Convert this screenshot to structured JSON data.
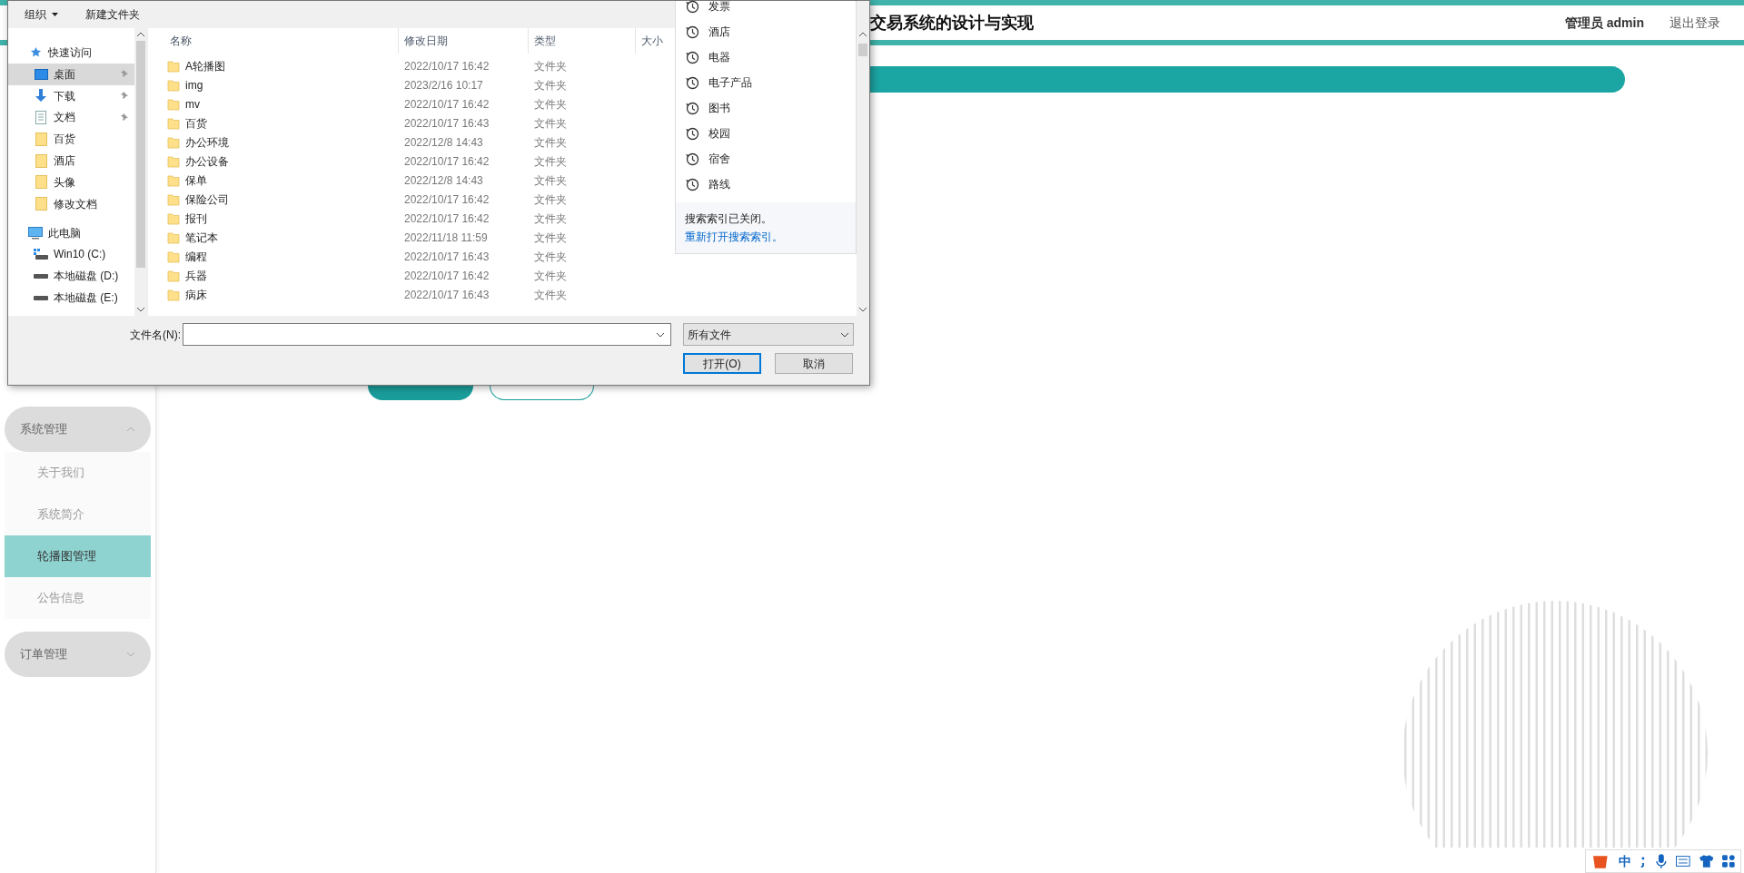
{
  "header": {
    "title": "交易系统的设计与实现",
    "user": "管理员 admin",
    "logout": "退出登录"
  },
  "sidebar": [
    {
      "label": "系统管理",
      "expanded": true,
      "children": [
        {
          "label": "关于我们",
          "selected": false
        },
        {
          "label": "系统简介",
          "selected": false
        },
        {
          "label": "轮播图管理",
          "selected": true
        },
        {
          "label": "公告信息",
          "selected": false
        }
      ]
    },
    {
      "label": "订单管理",
      "expanded": false
    }
  ],
  "dialog": {
    "toolbar": [
      {
        "label": "组织",
        "kind": "menu"
      },
      {
        "label": "新建文件夹",
        "kind": "button"
      }
    ],
    "nav": [
      {
        "label": "快速访问",
        "kind": "star",
        "selected": false,
        "pinned": false,
        "children": [
          {
            "label": "桌面",
            "kind": "desktop",
            "selected": true,
            "pinned": true
          },
          {
            "label": "下载",
            "kind": "download",
            "selected": false,
            "pinned": true
          },
          {
            "label": "文档",
            "kind": "document",
            "selected": false,
            "pinned": true
          },
          {
            "label": "百货",
            "kind": "folder",
            "selected": false,
            "pinned": false
          },
          {
            "label": "酒店",
            "kind": "folder",
            "selected": false,
            "pinned": false
          },
          {
            "label": "头像",
            "kind": "folder",
            "selected": false,
            "pinned": false
          },
          {
            "label": "修改文档",
            "kind": "folder",
            "selected": false,
            "pinned": false
          }
        ]
      },
      {
        "label": "此电脑",
        "kind": "pc",
        "selected": false,
        "pinned": false,
        "children": [
          {
            "label": "Win10 (C:)",
            "kind": "windrive",
            "selected": false,
            "pinned": false
          },
          {
            "label": "本地磁盘 (D:)",
            "kind": "drive",
            "selected": false,
            "pinned": false
          },
          {
            "label": "本地磁盘 (E:)",
            "kind": "drive",
            "selected": false,
            "pinned": false
          }
        ]
      }
    ],
    "columns": [
      "名称",
      "修改日期",
      "类型",
      "大小"
    ],
    "rows": [
      {
        "name": "A轮播图",
        "date": "2022/10/17 16:42",
        "type": "文件夹"
      },
      {
        "name": "img",
        "date": "2023/2/16 10:17",
        "type": "文件夹"
      },
      {
        "name": "mv",
        "date": "2022/10/17 16:42",
        "type": "文件夹"
      },
      {
        "name": "百货",
        "date": "2022/10/17 16:43",
        "type": "文件夹"
      },
      {
        "name": "办公环境",
        "date": "2022/12/8 14:43",
        "type": "文件夹"
      },
      {
        "name": "办公设备",
        "date": "2022/10/17 16:42",
        "type": "文件夹"
      },
      {
        "name": "保单",
        "date": "2022/12/8 14:43",
        "type": "文件夹"
      },
      {
        "name": "保险公司",
        "date": "2022/10/17 16:42",
        "type": "文件夹"
      },
      {
        "name": "报刊",
        "date": "2022/10/17 16:42",
        "type": "文件夹"
      },
      {
        "name": "笔记本",
        "date": "2022/11/18 11:59",
        "type": "文件夹"
      },
      {
        "name": "编程",
        "date": "2022/10/17 16:43",
        "type": "文件夹"
      },
      {
        "name": "兵器",
        "date": "2022/10/17 16:42",
        "type": "文件夹"
      },
      {
        "name": "病床",
        "date": "2022/10/17 16:43",
        "type": "文件夹"
      }
    ],
    "search_history": [
      "发票",
      "酒店",
      "电器",
      "电子产品",
      "图书",
      "校园",
      "宿舍",
      "路线"
    ],
    "search_notice": "搜索索引已关闭。",
    "search_link": "重新打开搜索索引。",
    "filename_label": "文件名(N):",
    "filter": "所有文件",
    "buttons": [
      {
        "label": "打开(O)",
        "default": true
      },
      {
        "label": "取消",
        "default": false
      }
    ]
  },
  "ime": {
    "label": "中"
  }
}
